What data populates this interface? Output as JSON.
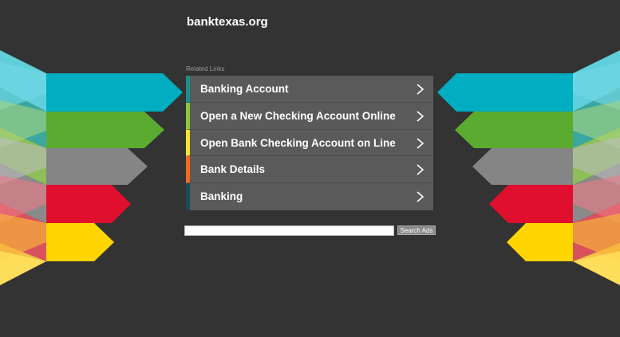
{
  "site": {
    "title": "banktexas.org"
  },
  "related": {
    "label": "Related Links"
  },
  "links": [
    {
      "label": "Banking Account",
      "accent": "#1d8f8a"
    },
    {
      "label": "Open a New Checking Account Online",
      "accent": "#8dc63f"
    },
    {
      "label": "Open Bank Checking Account on Line",
      "accent": "#f2e52b"
    },
    {
      "label": "Bank Details",
      "accent": "#f26a21"
    },
    {
      "label": "Banking",
      "accent": "#1a4a5a"
    }
  ],
  "search": {
    "value": "",
    "button_label": "Search Ads"
  },
  "colors": {
    "background": "#333333",
    "panel": "#5a5a5a",
    "teal": "#00adc1",
    "green": "#5bab30",
    "gray": "#858585",
    "red": "#e10f2e",
    "yellow": "#ffd500"
  }
}
